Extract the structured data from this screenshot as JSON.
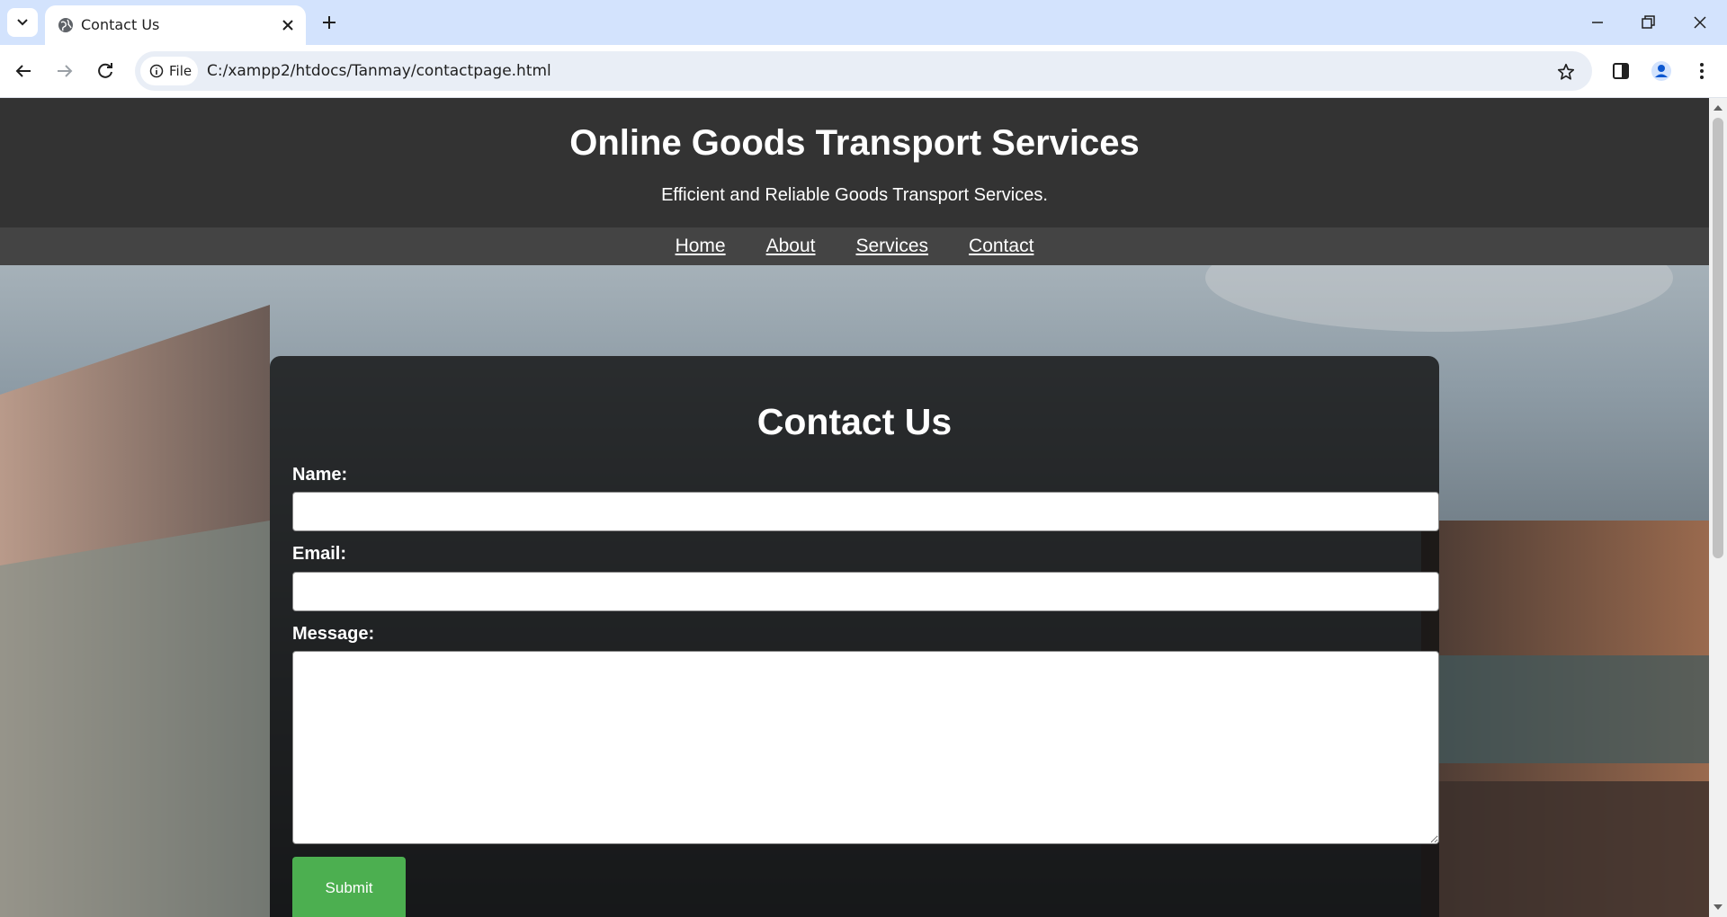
{
  "browser": {
    "tab_title": "Contact Us",
    "address_chip": "File",
    "url": "C:/xampp2/htdocs/Tanmay/contactpage.html"
  },
  "site": {
    "title": "Online Goods Transport Services",
    "tagline": "Efficient and Reliable Goods Transport Services.",
    "nav": [
      "Home",
      "About",
      "Services",
      "Contact"
    ]
  },
  "contact": {
    "heading": "Contact Us",
    "name_label": "Name:",
    "email_label": "Email:",
    "message_label": "Message:",
    "name_value": "",
    "email_value": "",
    "message_value": "",
    "submit_label": "Submit"
  },
  "colors": {
    "tabbar_bg": "#d3e3fd",
    "header_bg": "#333333",
    "nav_bg": "#444444",
    "submit_bg": "#4caf50"
  }
}
